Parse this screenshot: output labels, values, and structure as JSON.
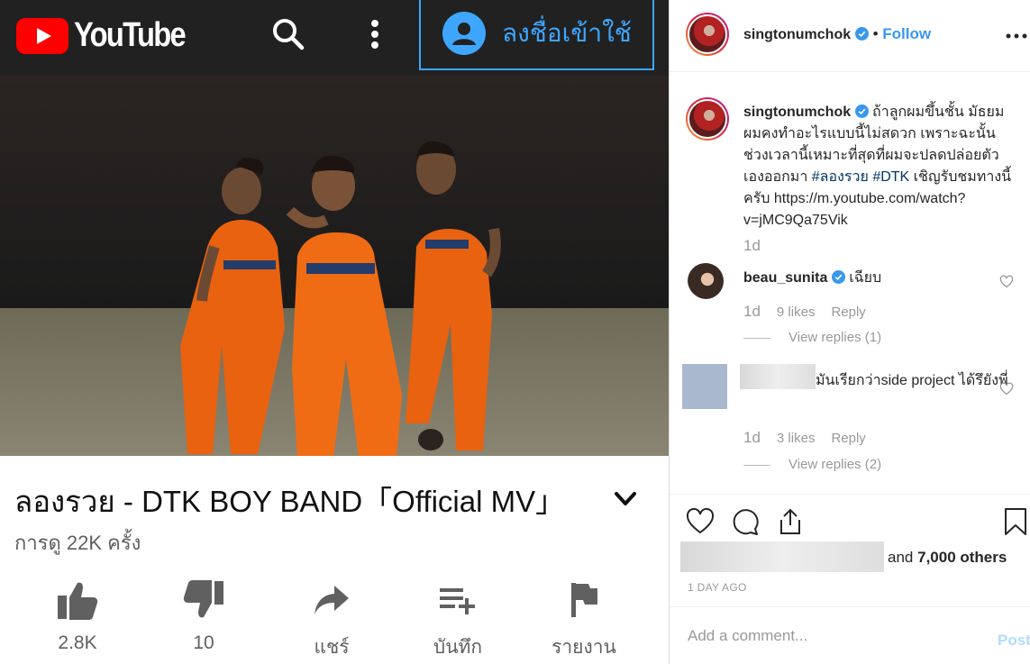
{
  "youtube": {
    "logo_text": "YouTube",
    "signin_label": "ลงชื่อเข้าใช้",
    "video_title": "ลองรวย - DTK BOY BAND「Official MV」",
    "views": "การดู 22K ครั้ง",
    "actions": [
      {
        "label": "2.8K",
        "icon": "thumbs-up-icon"
      },
      {
        "label": "10",
        "icon": "thumbs-down-icon"
      },
      {
        "label": "แชร์",
        "icon": "share-icon"
      },
      {
        "label": "บันทึก",
        "icon": "playlist-add-icon"
      },
      {
        "label": "รายงาน",
        "icon": "flag-icon"
      }
    ],
    "colors": {
      "brand": "#ff0000",
      "topbar": "#212121",
      "signin": "#3ea6ff"
    }
  },
  "instagram": {
    "header": {
      "username": "singtonumchok",
      "separator": "•",
      "follow_label": "Follow"
    },
    "caption": {
      "username": "singtonumchok",
      "text_1": "ถ้าลูกผมขึ้นชั้น มัธยม ผมคงทำอะไรแบบนี้ไม่สดวก เพราะฉะนั้น ช่วงเวลานี้เหมาะที่สุดที่ผมจะปลดปล่อยตัวเองออกมา",
      "tag_1": "#ลองรวย",
      "tag_2": "#DTK",
      "text_2": "เชิญรับชมทางนี้ครับ https://m.youtube.com/watch?v=jMC9Qa75Vik",
      "age": "1d"
    },
    "comments": [
      {
        "username": "beau_sunita",
        "text": "เฉียบ",
        "age": "1d",
        "likes": "9 likes",
        "reply": "Reply",
        "view_replies": "View replies (1)"
      },
      {
        "username": "",
        "text": "มันเรียกว่าside project ได้รึยังพี่",
        "age": "1d",
        "likes": "3 likes",
        "reply": "Reply",
        "view_replies": "View replies (2)"
      }
    ],
    "likes_text": "and",
    "likes_count": "7,000 others",
    "date": "1 DAY AGO",
    "add_comment_placeholder": "Add a comment...",
    "post_label": "Post",
    "colors": {
      "link": "#3897f0",
      "tag": "#003569",
      "muted": "#999999"
    }
  }
}
